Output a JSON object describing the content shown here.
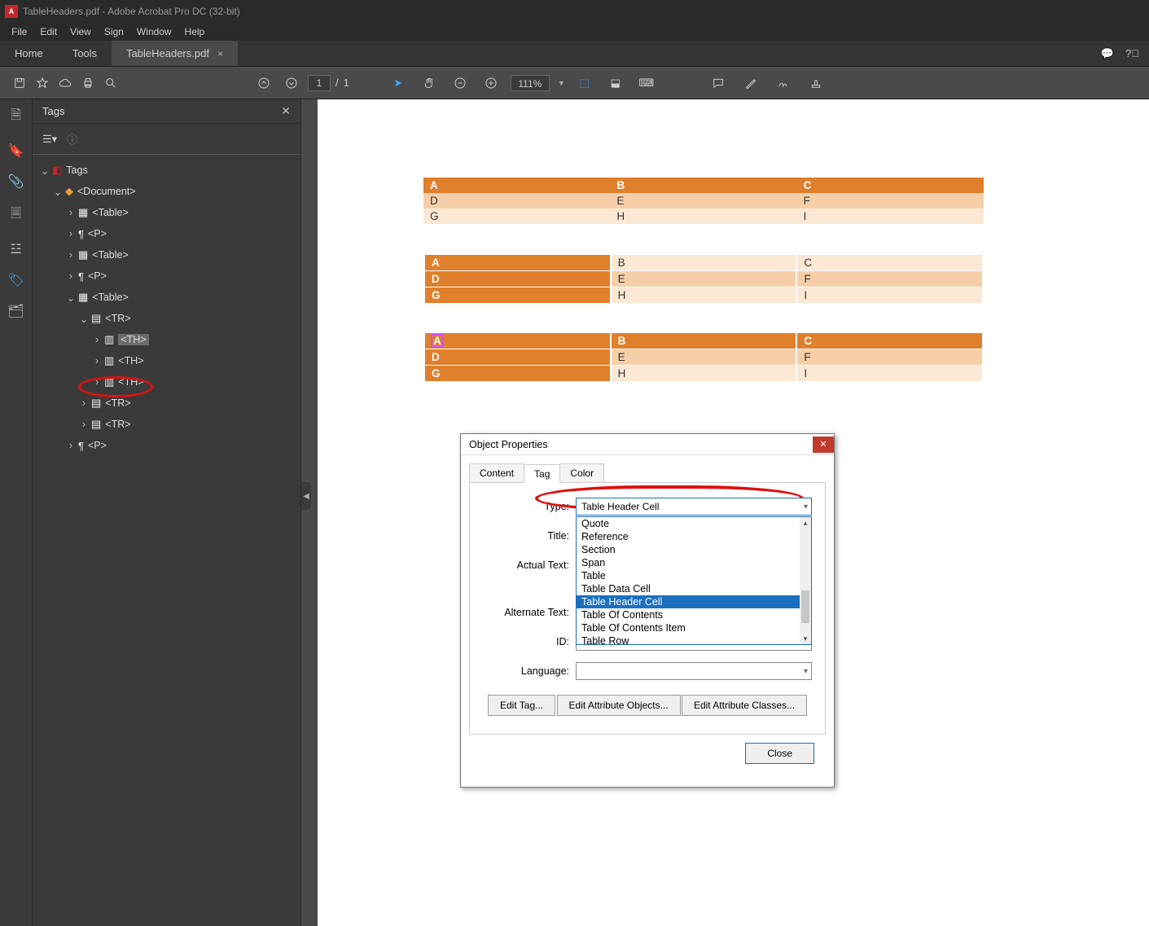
{
  "title": "TableHeaders.pdf - Adobe Acrobat Pro DC (32-bit)",
  "menu": [
    "File",
    "Edit",
    "View",
    "Sign",
    "Window",
    "Help"
  ],
  "tabs": {
    "home": "Home",
    "tools": "Tools",
    "file": "TableHeaders.pdf"
  },
  "page": {
    "cur": "1",
    "sep": "/",
    "total": "1"
  },
  "zoom": "111%",
  "panel": {
    "title": "Tags",
    "root": "Tags"
  },
  "tree": {
    "doc": "<Document>",
    "table": "<Table>",
    "p": "<P>",
    "tr": "<TR>",
    "th": "<TH>"
  },
  "tables": [
    {
      "rows": [
        [
          "A",
          "B",
          "C"
        ],
        [
          "D",
          "E",
          "F"
        ],
        [
          "G",
          "H",
          "I"
        ]
      ],
      "style": "header-row"
    },
    {
      "rows": [
        [
          "A",
          "B",
          "C"
        ],
        [
          "D",
          "E",
          "F"
        ],
        [
          "G",
          "H",
          "I"
        ]
      ],
      "style": "header-col"
    },
    {
      "rows": [
        [
          "A",
          "B",
          "C"
        ],
        [
          "D",
          "E",
          "F"
        ],
        [
          "G",
          "H",
          "I"
        ]
      ],
      "style": "header-both"
    }
  ],
  "dialog": {
    "title": "Object Properties",
    "tabs": [
      "Content",
      "Tag",
      "Color"
    ],
    "labels": {
      "type": "Type:",
      "title": "Title:",
      "actual": "Actual Text:",
      "alt": "Alternate Text:",
      "id": "ID:",
      "lang": "Language:"
    },
    "type_value": "Table Header Cell",
    "options": [
      "Quote",
      "Reference",
      "Section",
      "Span",
      "Table",
      "Table Data Cell",
      "Table Header Cell",
      "Table Of Contents",
      "Table Of Contents Item",
      "Table Row"
    ],
    "buttons": {
      "edit": "Edit Tag...",
      "attrobj": "Edit Attribute Objects...",
      "attrcls": "Edit Attribute Classes...",
      "close": "Close"
    }
  }
}
